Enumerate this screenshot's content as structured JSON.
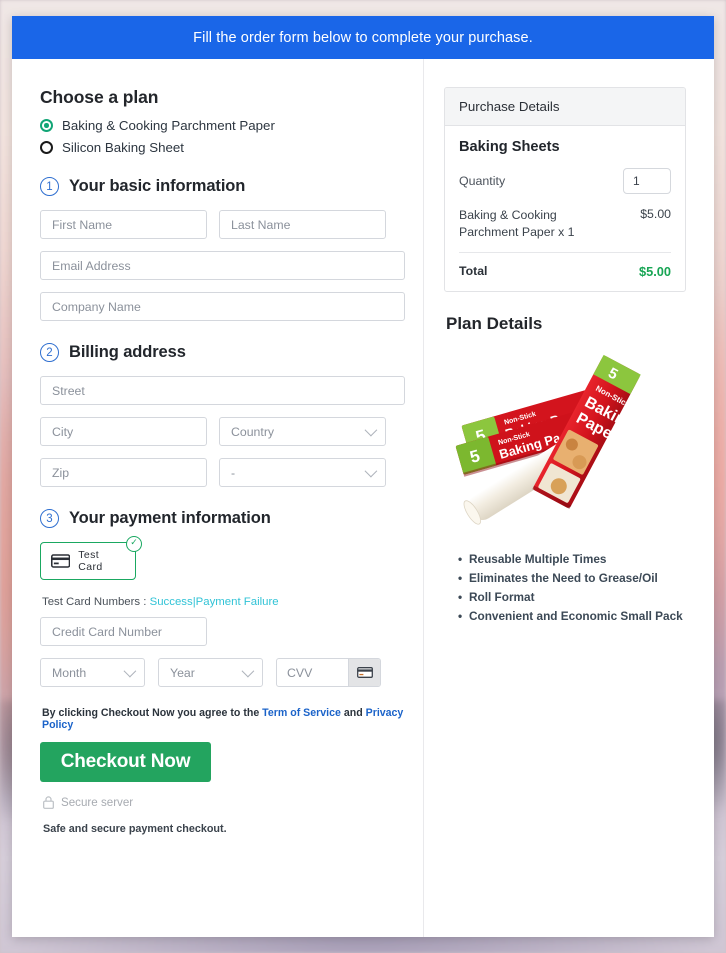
{
  "banner": {
    "text": "Fill the order form below to complete your purchase."
  },
  "left": {
    "choose_plan_title": "Choose a plan",
    "plans": [
      {
        "label": "Baking & Cooking Parchment Paper",
        "selected": true
      },
      {
        "label": "Silicon Baking Sheet",
        "selected": false
      }
    ],
    "step1": {
      "number": "1",
      "title": "Your basic information",
      "first_name_placeholder": "First Name",
      "last_name_placeholder": "Last Name",
      "email_placeholder": "Email Address",
      "company_placeholder": "Company Name"
    },
    "step2": {
      "number": "2",
      "title": "Billing address",
      "street_placeholder": "Street",
      "city_placeholder": "City",
      "country_placeholder": "Country",
      "zip_placeholder": "Zip",
      "state_placeholder": "-"
    },
    "step3": {
      "number": "3",
      "title": "Your payment information",
      "card_tile_label": "Test  Card",
      "card_tile_check": "✓",
      "test_cards_prefix": "Test Card Numbers :",
      "test_card_success": "Success",
      "test_card_separator": "|",
      "test_card_failure": "Payment Failure",
      "credit_card_placeholder": "Credit Card Number",
      "month_placeholder": "Month",
      "year_placeholder": "Year",
      "cvv_placeholder": "CVV"
    },
    "agreement": {
      "prefix": "By clicking Checkout Now you agree to the",
      "terms_link": "Term of Service",
      "and": "and",
      "privacy_link": "Privacy Policy"
    },
    "checkout_button": "Checkout Now",
    "secure_server": "Secure server",
    "safe_note": "Safe and secure payment checkout."
  },
  "right": {
    "purchase_details_title": "Purchase Details",
    "product_title": "Baking Sheets",
    "quantity_label": "Quantity",
    "quantity_value": "1",
    "item_name": "Baking & Cooking Parchment Paper x 1",
    "item_price": "$5.00",
    "total_label": "Total",
    "total_value": "$5.00",
    "plan_details_title": "Plan Details",
    "features": [
      "Reusable Multiple Times",
      "Eliminates the Need to Grease/Oil",
      "Roll Format",
      "Convenient and Economic Small Pack"
    ]
  },
  "colors": {
    "banner_blue": "#1a66e8",
    "accent_green": "#23a45f",
    "total_green": "#17a554",
    "link_cyan": "#31c3d6",
    "link_blue": "#1b63c9",
    "step_blue": "#2f6fd0"
  }
}
